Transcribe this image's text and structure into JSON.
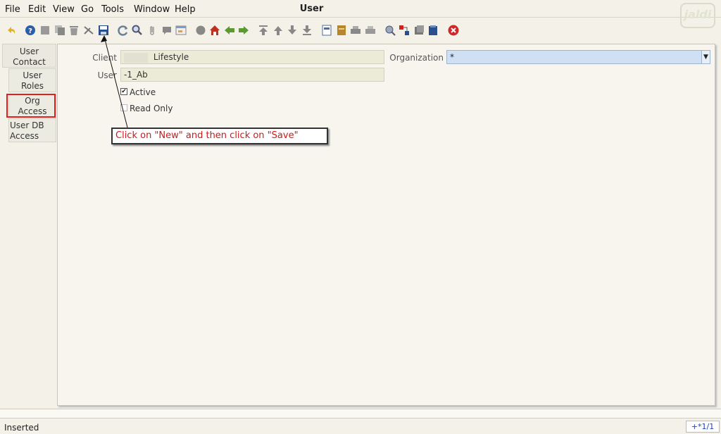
{
  "window": {
    "title": "User",
    "logo": "jaldi"
  },
  "menu": [
    "File",
    "Edit",
    "View",
    "Go",
    "Tools",
    "Window",
    "Help"
  ],
  "toolbar_icons": [
    "undo-icon",
    "help-icon",
    "new-icon",
    "copy-icon",
    "delete-icon",
    "delete-selection-icon",
    "save-icon",
    "refresh-icon",
    "find-icon",
    "attachment-icon",
    "chat-icon",
    "history-icon",
    "home-icon",
    "parent-icon",
    "back-icon",
    "forward-icon",
    "first-record-icon",
    "previous-record-icon",
    "next-record-icon",
    "last-record-icon",
    "report-icon",
    "archive-icon",
    "print-icon",
    "print-preview-icon",
    "zoom-across-icon",
    "workflow-icon",
    "request-icon",
    "product-info-icon",
    "exit-icon"
  ],
  "tabs": [
    "User Contact",
    "User Roles",
    "Org Access",
    "User DB Access"
  ],
  "form": {
    "client_label": "Client",
    "client_value": "Lifestyle",
    "org_label": "Organization",
    "org_value": "*",
    "user_label": "User",
    "user_value": "-1_Ab",
    "active_label": "Active",
    "active_checked": true,
    "readonly_label": "Read Only",
    "readonly_checked": false
  },
  "callout": "Click on \"New\" and then click on \"Save\"",
  "status": {
    "text": "Inserted",
    "record": "+*1/1"
  },
  "colors": {
    "callout_text": "#d01818",
    "highlight": "#e02020",
    "org_field": "#cfe0f4"
  }
}
